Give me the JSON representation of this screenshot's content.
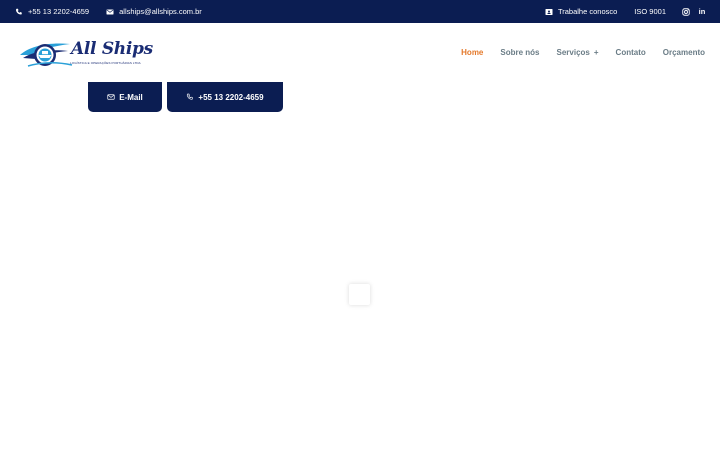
{
  "topbar": {
    "phone": "+55 13 2202-4659",
    "email": "allships@allships.com.br",
    "work_with_us": "Trabalhe conosco",
    "iso": "ISO 9001",
    "linkedin_label": "in"
  },
  "brand": {
    "name": "All Ships",
    "tagline": "LOGÍSTICA E OPERAÇÕES PORTUÁRIAS LTDA",
    "logo_primary": "#1a2c74",
    "logo_accent": "#2aa0d8"
  },
  "nav": {
    "items": [
      {
        "label": "Home",
        "active": true
      },
      {
        "label": "Sobre nós",
        "active": false
      },
      {
        "label": "Serviços",
        "active": false,
        "has_submenu": true,
        "submenu_marker": "+"
      },
      {
        "label": "Contato",
        "active": false
      },
      {
        "label": "Orçamento",
        "active": false
      }
    ]
  },
  "hero": {
    "email_button": "E-Mail",
    "phone_button": "+55 13 2202-4659"
  },
  "icons": {
    "phone": "phone-icon",
    "mail": "mail-icon",
    "id_card": "id-card-icon",
    "instagram": "instagram-icon",
    "linkedin": "linkedin-icon"
  },
  "colors": {
    "navy": "#0b1d52",
    "nav_text": "#6a7c86",
    "nav_active": "#e4792b",
    "white": "#ffffff"
  }
}
